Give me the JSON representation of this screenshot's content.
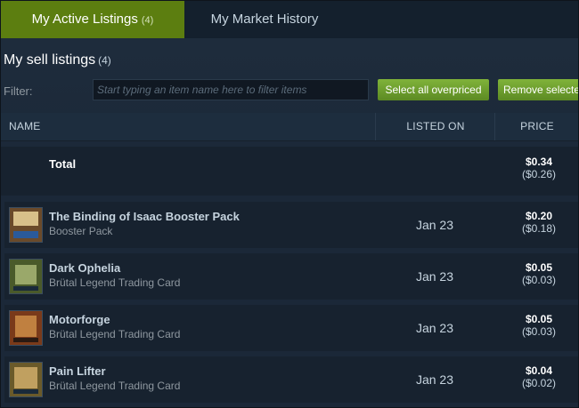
{
  "tabs": [
    {
      "label": "My Active Listings",
      "count": "(4)"
    },
    {
      "label": "My Market History"
    }
  ],
  "section": {
    "title": "My sell listings",
    "count": "(4)"
  },
  "filter": {
    "label": "Filter:",
    "placeholder": "Start typing an item name here to filter items"
  },
  "buttons": {
    "select_overpriced": "Select all overpriced",
    "remove_selected": "Remove selecte"
  },
  "table": {
    "headers": {
      "name": "NAME",
      "listed_on": "LISTED ON",
      "price": "PRICE"
    },
    "total": {
      "label": "Total",
      "price": "$0.34",
      "price_sub": "($0.26)"
    },
    "rows": [
      {
        "name": "The Binding of Isaac Booster Pack",
        "type": "Booster Pack",
        "listed_on": "Jan 23",
        "price": "$0.20",
        "price_sub": "($0.18)",
        "thumb_colors": [
          "#6a4a2a",
          "#d8c08a",
          "#2a5a9a"
        ]
      },
      {
        "name": "Dark Ophelia",
        "type": "Brütal Legend Trading Card",
        "listed_on": "Jan 23",
        "price": "$0.05",
        "price_sub": "($0.03)",
        "thumb_colors": [
          "#4a5a2a",
          "#9aa86a",
          "#1a2a3a"
        ]
      },
      {
        "name": "Motorforge",
        "type": "Brütal Legend Trading Card",
        "listed_on": "Jan 23",
        "price": "$0.05",
        "price_sub": "($0.03)",
        "thumb_colors": [
          "#7a3a1a",
          "#c08040",
          "#2a1a12"
        ]
      },
      {
        "name": "Pain Lifter",
        "type": "Brütal Legend Trading Card",
        "listed_on": "Jan 23",
        "price": "$0.04",
        "price_sub": "($0.02)",
        "thumb_colors": [
          "#6a5a2a",
          "#c0a060",
          "#1a2a3a"
        ]
      }
    ]
  }
}
